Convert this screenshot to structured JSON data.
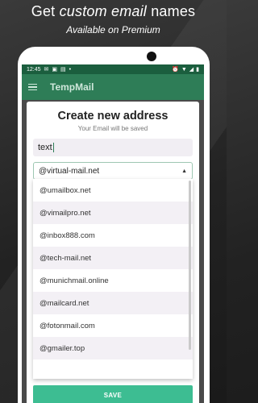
{
  "promo": {
    "headline_prefix": "Get ",
    "headline_emphasis": "custom email",
    "headline_suffix": " names",
    "subline": "Available on Premium"
  },
  "statusbar": {
    "time": "12:45",
    "left_icons": [
      "email-icon",
      "app-icon",
      "image-icon",
      "dot-icon"
    ],
    "right_icons": [
      "alarm-icon",
      "wifi-icon",
      "signal-icon",
      "battery-icon"
    ]
  },
  "appbar": {
    "title": "TempMail",
    "menu_icon": "hamburger-menu-icon"
  },
  "dialog": {
    "title": "Create new address",
    "subtitle": "Your Email will be saved",
    "name_value": "text",
    "domain_selected": "@virtual-mail.net",
    "domain_options": [
      "@umailbox.net",
      "@vimailpro.net",
      "@inbox888.com",
      "@tech-mail.net",
      "@munichmail.online",
      "@mailcard.net",
      "@fotonmail.com",
      "@gmailer.top"
    ],
    "save_label": "SAVE"
  },
  "colors": {
    "statusbar": "#1b5e3e",
    "appbar": "#2e7d57",
    "save_button": "#3dbd92"
  }
}
